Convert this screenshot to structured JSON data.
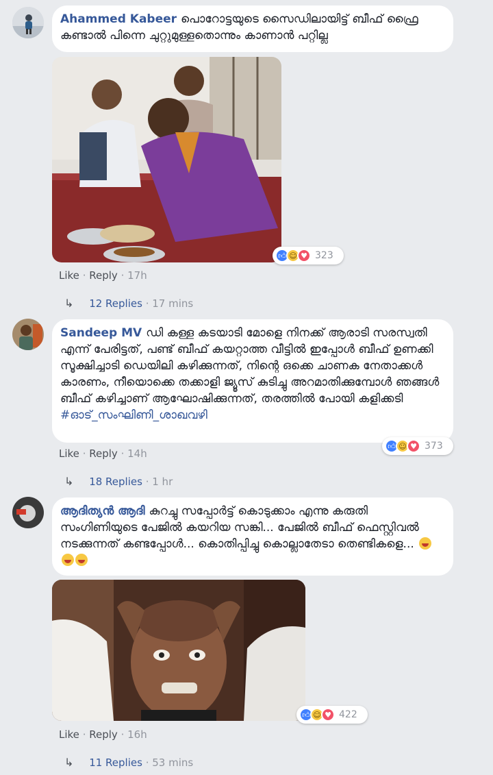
{
  "comments": [
    {
      "author": "Ahammed Kabeer",
      "text": "പൊറോട്ടയുടെ സൈഡിലായിട്ട് ബീഫ് ഫ്രൈ കണ്ടാൽ പിന്നെ ചുറ്റുമുള്ളതൊന്നും കാണാൻ പറ്റില്ല",
      "reaction_count": "323",
      "like_label": "Like",
      "reply_label": "Reply",
      "time": "17h",
      "replies_label": "12 Replies",
      "replies_time": "17 mins"
    },
    {
      "author": "Sandeep MV",
      "text": "ഡി കള്ള കടയാടി മോളെ നിനക്ക് ആരാടി സരസ്വതി എന്ന് പേരിട്ടത്, പണ്ട് ബീഫ് കയറ്റാത്ത വീട്ടിൽ ഇപ്പോൾ ബീഫ് ഉണക്കി സൂക്ഷിച്ചാടി ഡെയിലി കഴിക്കുന്നത്, നിന്റെ ഒക്കെ ചാണക നേതാക്കൾ കാരണം, നീയൊക്കെ തക്കാളി ജ്യൂസ് കുടിച്ചു അറമാതിക്കുമ്പോൾ ഞങ്ങൾ ബീഫ് കഴിച്ചാണ് ആഘോഷിക്കുന്നത്, തരത്തിൽ പോയി കളിക്കടി",
      "hashtag": "#ഓട്_സംഘിണി_ശാഖവഴി",
      "reaction_count": "373",
      "like_label": "Like",
      "reply_label": "Reply",
      "time": "14h",
      "replies_label": "18 Replies",
      "replies_time": "1 hr"
    },
    {
      "author": "ആദിത്യൻ ആദി",
      "text": "കുറച്ചു സപ്പോർട്ട് കൊടുക്കാം എന്നു കരുതി സംഗിണിയുടെ പേജിൽ കയറിയ സങ്കി... പേജിൽ ബീഫ് ഫെസ്റ്റിവൽ നടക്കുന്നത് കണ്ടപ്പോൾ... കൊതിപ്പിച്ചു കൊല്ലാതേടാ തെണ്ടികളെ...",
      "reaction_count": "422",
      "like_label": "Like",
      "reply_label": "Reply",
      "time": "16h",
      "replies_label": "11 Replies",
      "replies_time": "53 mins"
    }
  ],
  "icons": {
    "reply_arrow": "reply-arrow-icon",
    "like": "like-reaction-icon",
    "haha": "haha-reaction-icon",
    "love": "love-reaction-icon"
  },
  "colors": {
    "author": "#365899",
    "background": "#e9ebee",
    "bubble": "#ffffff",
    "meta": "#90949c"
  }
}
